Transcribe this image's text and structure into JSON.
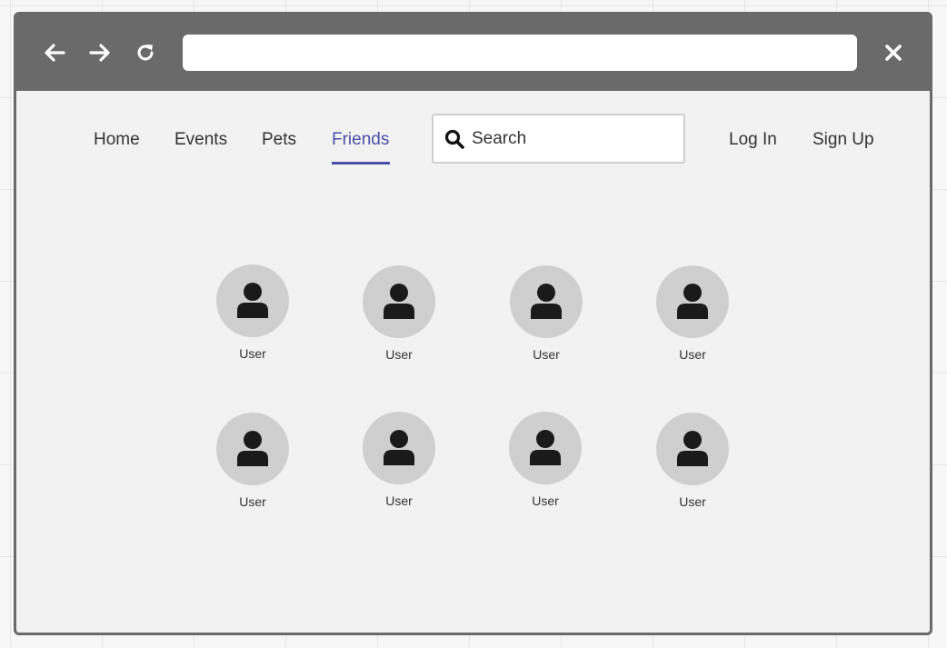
{
  "browser": {
    "back_icon": "arrow-left-icon",
    "forward_icon": "arrow-right-icon",
    "reload_icon": "reload-icon",
    "close_icon": "close-icon",
    "address_value": ""
  },
  "nav": {
    "items": [
      {
        "label": "Home",
        "active": false
      },
      {
        "label": "Events",
        "active": false
      },
      {
        "label": "Pets",
        "active": false
      },
      {
        "label": "Friends",
        "active": true
      }
    ],
    "active_color": "#4a4fa8"
  },
  "search": {
    "icon": "search-icon",
    "placeholder": "Search",
    "value": ""
  },
  "auth": {
    "login_label": "Log In",
    "signup_label": "Sign Up"
  },
  "users": [
    {
      "label": "User",
      "icon": "user-icon"
    },
    {
      "label": "User",
      "icon": "user-icon"
    },
    {
      "label": "User",
      "icon": "user-icon"
    },
    {
      "label": "User",
      "icon": "user-icon"
    },
    {
      "label": "User",
      "icon": "user-icon"
    },
    {
      "label": "User",
      "icon": "user-icon"
    },
    {
      "label": "User",
      "icon": "user-icon"
    },
    {
      "label": "User",
      "icon": "user-icon"
    }
  ],
  "colors": {
    "chrome": "#6a6a6a",
    "avatar_bg": "#cfcfcf",
    "page_bg": "#f2f2f2"
  }
}
